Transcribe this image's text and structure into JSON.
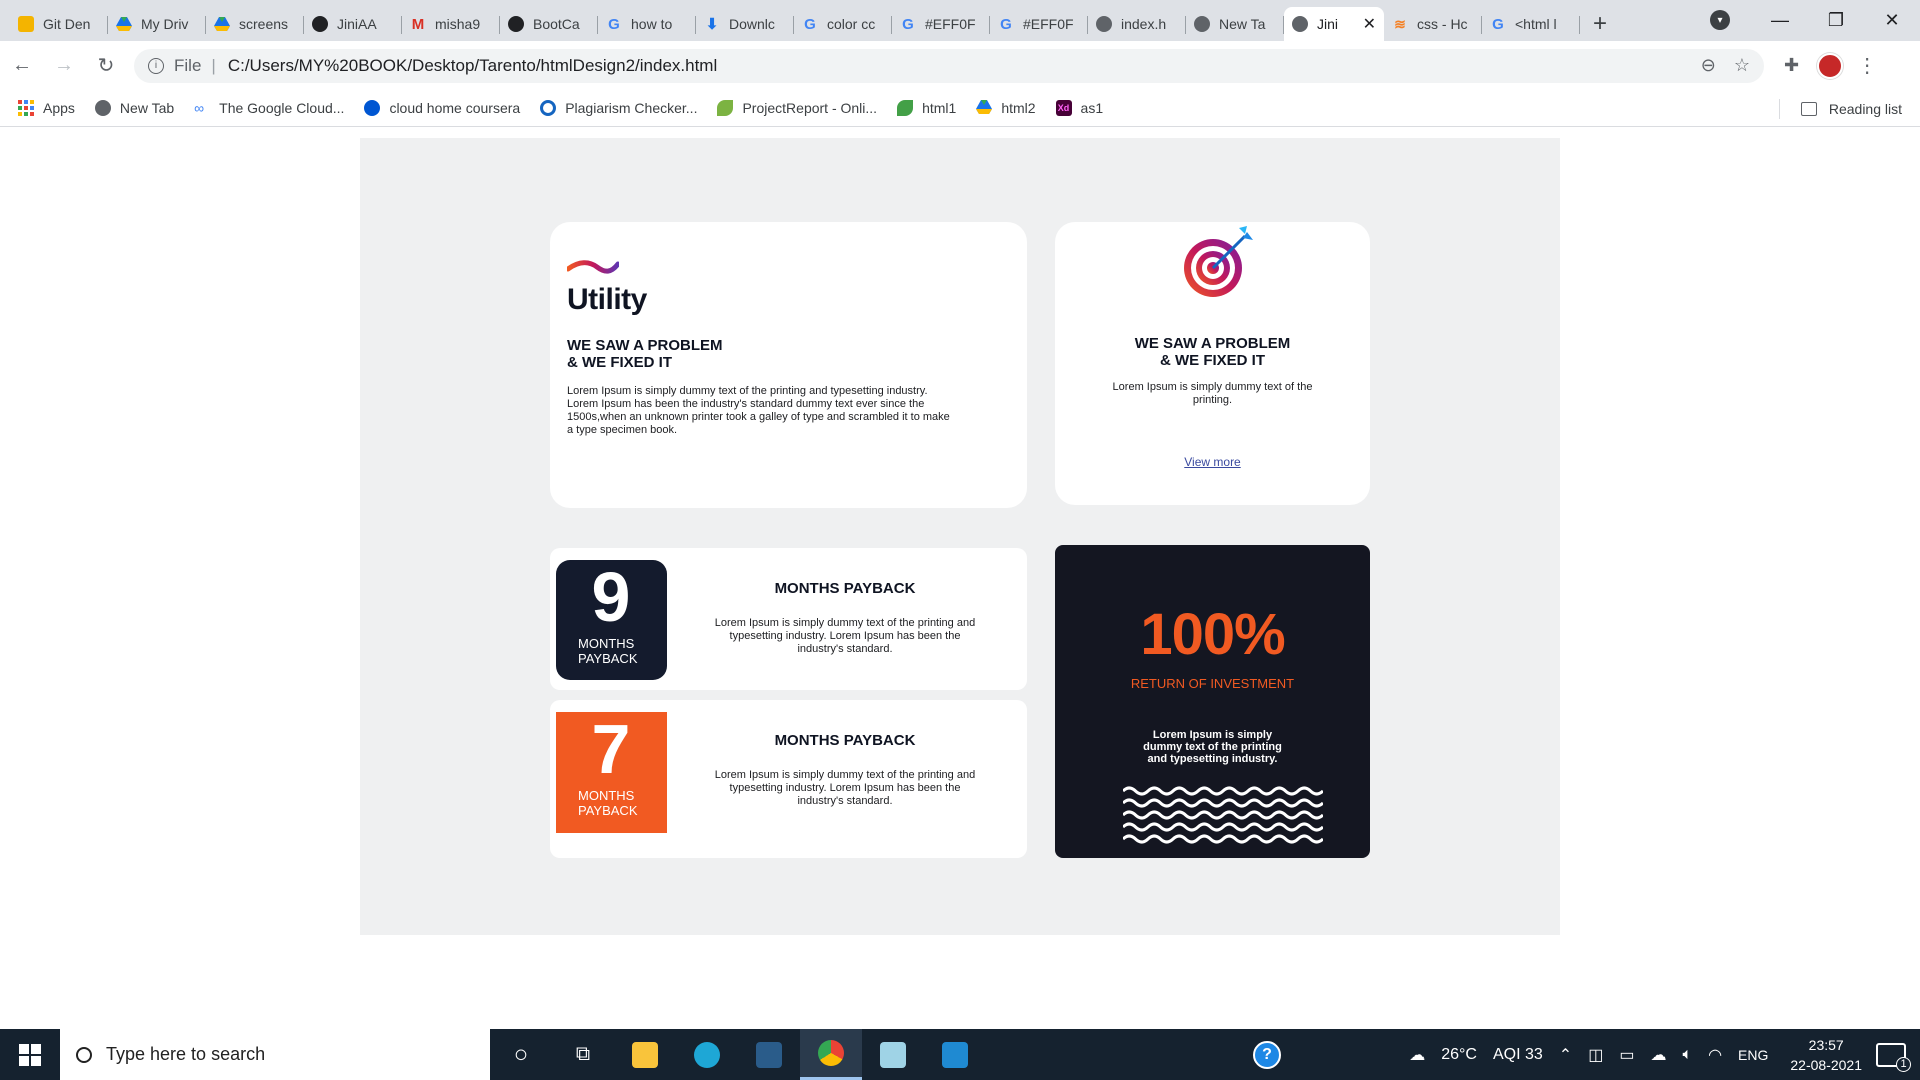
{
  "browser": {
    "tabs": [
      {
        "label": "Git Den",
        "icon": "slides-icon",
        "color": "#f4b400"
      },
      {
        "label": "My Driv",
        "icon": "drive-icon",
        "color": "#1a73e8"
      },
      {
        "label": "screens",
        "icon": "drive-icon",
        "color": "#1a73e8"
      },
      {
        "label": "JiniAA",
        "icon": "github-icon",
        "color": "#202124"
      },
      {
        "label": "misha9",
        "icon": "gmail-icon",
        "color": "#d93025"
      },
      {
        "label": "BootCa",
        "icon": "github-icon",
        "color": "#202124"
      },
      {
        "label": "how to",
        "icon": "google-icon",
        "color": "#4285f4"
      },
      {
        "label": "Downlc",
        "icon": "download-icon",
        "color": "#1a73e8"
      },
      {
        "label": "color cc",
        "icon": "google-icon",
        "color": "#4285f4"
      },
      {
        "label": "#EFF0F",
        "icon": "google-icon",
        "color": "#4285f4"
      },
      {
        "label": "#EFF0F",
        "icon": "google-icon",
        "color": "#4285f4"
      },
      {
        "label": "index.h",
        "icon": "globe-icon",
        "color": "#5f6368"
      },
      {
        "label": "New Ta",
        "icon": "chrome-icon",
        "color": "#5f6368"
      },
      {
        "label": "Jini",
        "icon": "globe-icon",
        "color": "#5f6368",
        "active": true
      },
      {
        "label": "css - Hc",
        "icon": "stackoverflow-icon",
        "color": "#f48024"
      },
      {
        "label": "<html l",
        "icon": "google-icon",
        "color": "#4285f4"
      }
    ],
    "new_tab": "+",
    "close_tab": "✕",
    "address": {
      "scheme": "File",
      "url": "C:/Users/MY%20BOOK/Desktop/Tarento/htmlDesign2/index.html"
    },
    "bookmarks": [
      {
        "label": "Apps",
        "icon": "apps-grid-icon"
      },
      {
        "label": "New Tab",
        "icon": "globe-icon"
      },
      {
        "label": "The Google Cloud...",
        "icon": "cloud-infinity-icon"
      },
      {
        "label": "cloud home coursera",
        "icon": "coursera-icon"
      },
      {
        "label": "Plagiarism Checker...",
        "icon": "plagiarism-icon"
      },
      {
        "label": "ProjectReport - Onli...",
        "icon": "leaf-icon"
      },
      {
        "label": "html1",
        "icon": "leaf-icon"
      },
      {
        "label": "html2",
        "icon": "drive-icon"
      },
      {
        "label": "as1",
        "icon": "xd-icon"
      }
    ],
    "reading_list": "Reading list"
  },
  "page": {
    "utility_card": {
      "title": "Utility",
      "heading_line1": "WE SAW A PROBLEM",
      "heading_line2": "& WE FIXED IT",
      "text": "Lorem Ipsum is simply dummy text of the printing and typesetting industry. Lorem Ipsum has been the industry's standard dummy text ever since the 1500s,when an unknown printer took a galley of type and scrambled it to make a type specimen book."
    },
    "target_card": {
      "heading_line1": "WE SAW A PROBLEM",
      "heading_line2": "& WE FIXED IT",
      "text": "Lorem Ipsum is simply dummy text of the printing.",
      "link": "View more"
    },
    "payback_rows": [
      {
        "number": "9",
        "label_line1": "MONTHS",
        "label_line2": "PAYBACK",
        "title": "MONTHS PAYBACK",
        "text": "Lorem Ipsum is simply dummy text of the printing and typesetting industry. Lorem Ipsum has been the industry's standard.",
        "style": "dark"
      },
      {
        "number": "7",
        "label_line1": "MONTHS",
        "label_line2": "PAYBACK",
        "title": "MONTHS PAYBACK",
        "text": "Lorem Ipsum is simply dummy text of the printing and typesetting industry. Lorem Ipsum has been the industry's standard.",
        "style": "orange"
      }
    ],
    "roi_card": {
      "value": "100%",
      "label": "RETURN OF INVESTMENT",
      "text": "Lorem Ipsum is simply dummy text of the printing and typesetting industry."
    },
    "colors": {
      "canvas": "#EFF0F1",
      "dark": "#141B2D",
      "accent": "#F15A22"
    }
  },
  "taskbar": {
    "search_placeholder": "Type here to search",
    "weather": "26°C",
    "aqi": "AQI 33",
    "language": "ENG",
    "time": "23:57",
    "date": "22-08-2021",
    "notification_count": "1"
  }
}
